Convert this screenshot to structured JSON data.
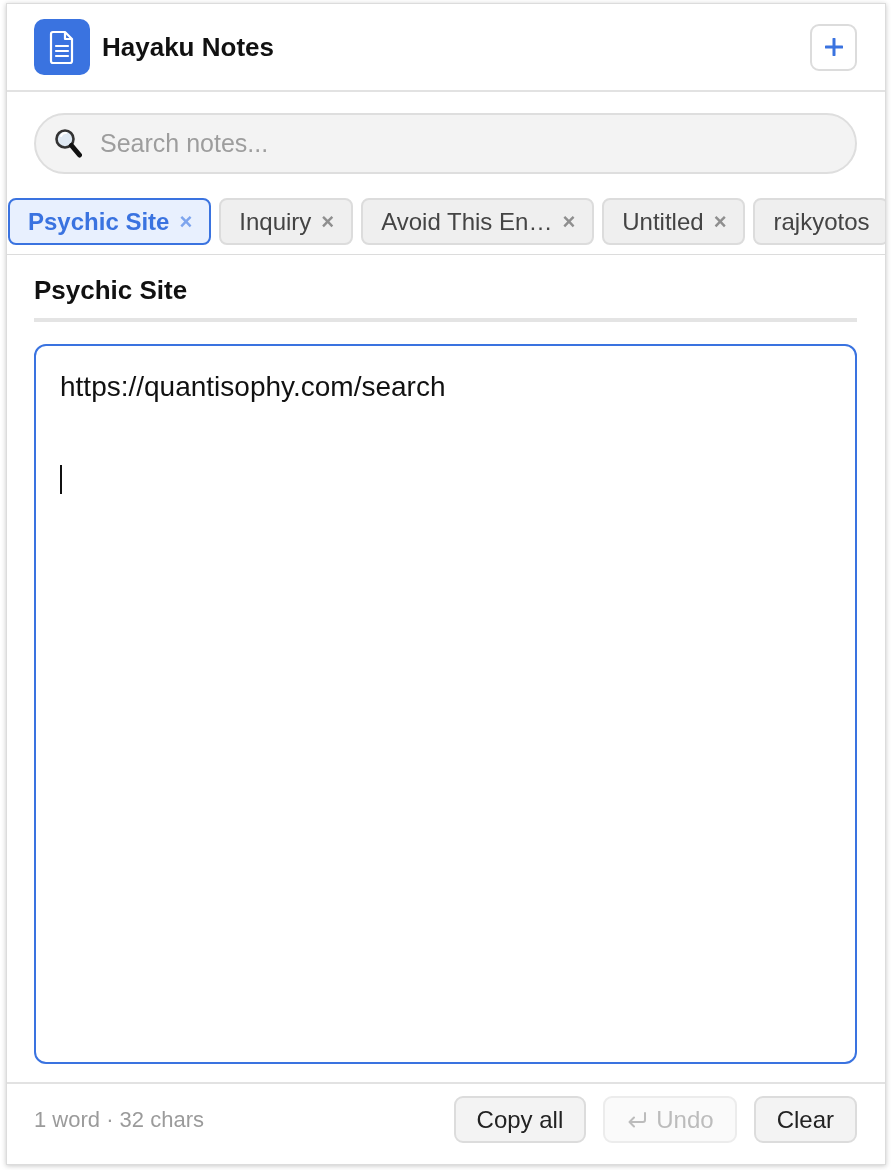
{
  "app": {
    "title": "Hayaku Notes"
  },
  "search": {
    "placeholder": "Search notes..."
  },
  "tabs": [
    {
      "label": "Psychic Site",
      "selected": true,
      "close": "×"
    },
    {
      "label": "Inquiry",
      "selected": false,
      "close": "×"
    },
    {
      "label": "Avoid This En…",
      "selected": false,
      "close": "×"
    },
    {
      "label": "Untitled",
      "selected": false,
      "close": "×"
    },
    {
      "label": "rajkyotos",
      "selected": false
    }
  ],
  "note": {
    "title": "Psychic Site",
    "value": "https://quantisophy.com/search\n\n",
    "focused": true
  },
  "footer": {
    "stats": "1 word · 32 chars",
    "buttons": [
      {
        "label": "Copy all",
        "kind": "text",
        "disabled": false
      },
      {
        "label": "Undo",
        "kind": "undo",
        "disabled": true
      },
      {
        "label": "Clear",
        "kind": "text",
        "disabled": false
      }
    ]
  }
}
